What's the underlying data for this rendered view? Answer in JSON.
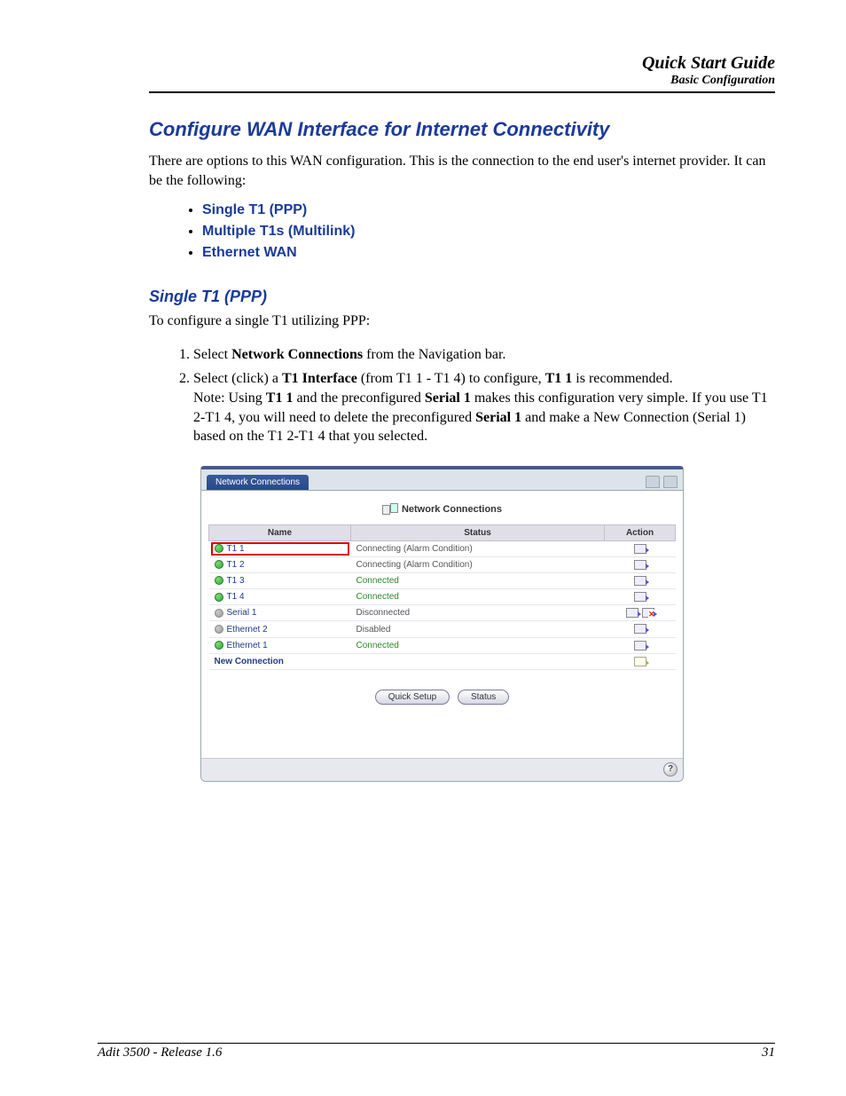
{
  "header": {
    "title": "Quick Start Guide",
    "subtitle": "Basic Configuration"
  },
  "section_title": "Configure WAN Interface for Internet Connectivity",
  "intro": "There are options to this WAN configuration. This is the connection to the end user's internet provider. It can be the following:",
  "options": [
    "Single T1 (PPP)",
    "Multiple T1s (Multilink)",
    "Ethernet WAN"
  ],
  "sub_title": "Single T1 (PPP)",
  "sub_intro": "To configure a single T1 utilizing PPP:",
  "steps": {
    "s1_a": "Select ",
    "s1_b": "Network Connections",
    "s1_c": " from the Navigation bar.",
    "s2_a": "Select (click) a ",
    "s2_b": "T1 Interface",
    "s2_c": " (from T1 1 - T1 4) to configure, ",
    "s2_d": "T1 1",
    "s2_e": " is recommended.",
    "s2_note_a": "Note: Using ",
    "s2_note_b": "T1 1",
    "s2_note_c": " and the preconfigured ",
    "s2_note_d": "Serial 1",
    "s2_note_e": " makes this configuration very simple. If you use T1 2-T1 4, you will need to delete the preconfigured ",
    "s2_note_f": "Serial 1",
    "s2_note_g": " and make a New Connection (Serial 1) based on the T1 2-T1 4 that you selected."
  },
  "screenshot": {
    "tab": "Network Connections",
    "panel_title": "Network Connections",
    "columns": {
      "name": "Name",
      "status": "Status",
      "action": "Action"
    },
    "rows": [
      {
        "name": "T1 1",
        "status": "Connecting (Alarm Condition)",
        "green": false,
        "highlight": true,
        "icongray": false,
        "del": false
      },
      {
        "name": "T1 2",
        "status": "Connecting (Alarm Condition)",
        "green": false,
        "highlight": false,
        "icongray": false,
        "del": false
      },
      {
        "name": "T1 3",
        "status": "Connected",
        "green": true,
        "highlight": false,
        "icongray": false,
        "del": false
      },
      {
        "name": "T1 4",
        "status": "Connected",
        "green": true,
        "highlight": false,
        "icongray": false,
        "del": false
      },
      {
        "name": "Serial 1",
        "status": "Disconnected",
        "green": false,
        "highlight": false,
        "icongray": true,
        "del": true
      },
      {
        "name": "Ethernet 2",
        "status": "Disabled",
        "green": false,
        "highlight": false,
        "icongray": true,
        "del": false
      },
      {
        "name": "Ethernet 1",
        "status": "Connected",
        "green": true,
        "highlight": false,
        "icongray": false,
        "del": false
      }
    ],
    "new_connection": "New Connection",
    "buttons": {
      "quick_setup": "Quick Setup",
      "status": "Status"
    },
    "help": "?"
  },
  "footer": {
    "left": "Adit 3500  - Release 1.6",
    "right": "31"
  }
}
